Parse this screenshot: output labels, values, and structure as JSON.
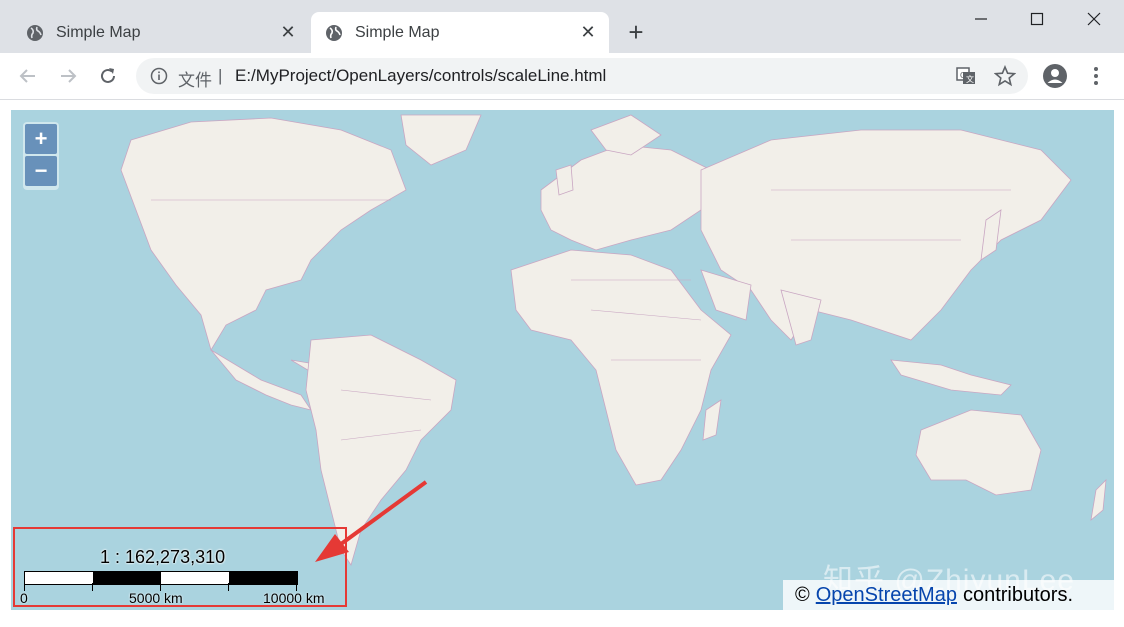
{
  "browser": {
    "tabs": [
      {
        "title": "Simple Map",
        "active": false
      },
      {
        "title": "Simple Map",
        "active": true
      }
    ],
    "new_tab_icon": "plus-icon",
    "window_controls": [
      "minimize-icon",
      "maximize-icon",
      "close-icon"
    ]
  },
  "toolbar": {
    "back_icon": "arrow-left-icon",
    "forward_icon": "arrow-right-icon",
    "reload_icon": "reload-icon",
    "site_info_icon": "info-icon",
    "file_label": "文件",
    "separator": "|",
    "url": "E:/MyProject/OpenLayers/controls/scaleLine.html",
    "translate_icon": "translate-icon",
    "bookmark_icon": "star-icon",
    "profile_icon": "account-icon",
    "menu_icon": "more-vertical-icon"
  },
  "map": {
    "zoom_in_label": "+",
    "zoom_out_label": "−",
    "scale_ratio": "1 : 162,273,310",
    "scale_labels": [
      "0",
      "5000 km",
      "10000 km"
    ],
    "attribution_prefix": "©",
    "attribution_link": "OpenStreetMap",
    "attribution_suffix": "contributors.",
    "watermark": "知乎 @ZhiyunLee",
    "colors": {
      "water": "#aad3df",
      "land": "#f2efe9",
      "border": "#c9a6c2",
      "highlight": "#e53935"
    }
  }
}
